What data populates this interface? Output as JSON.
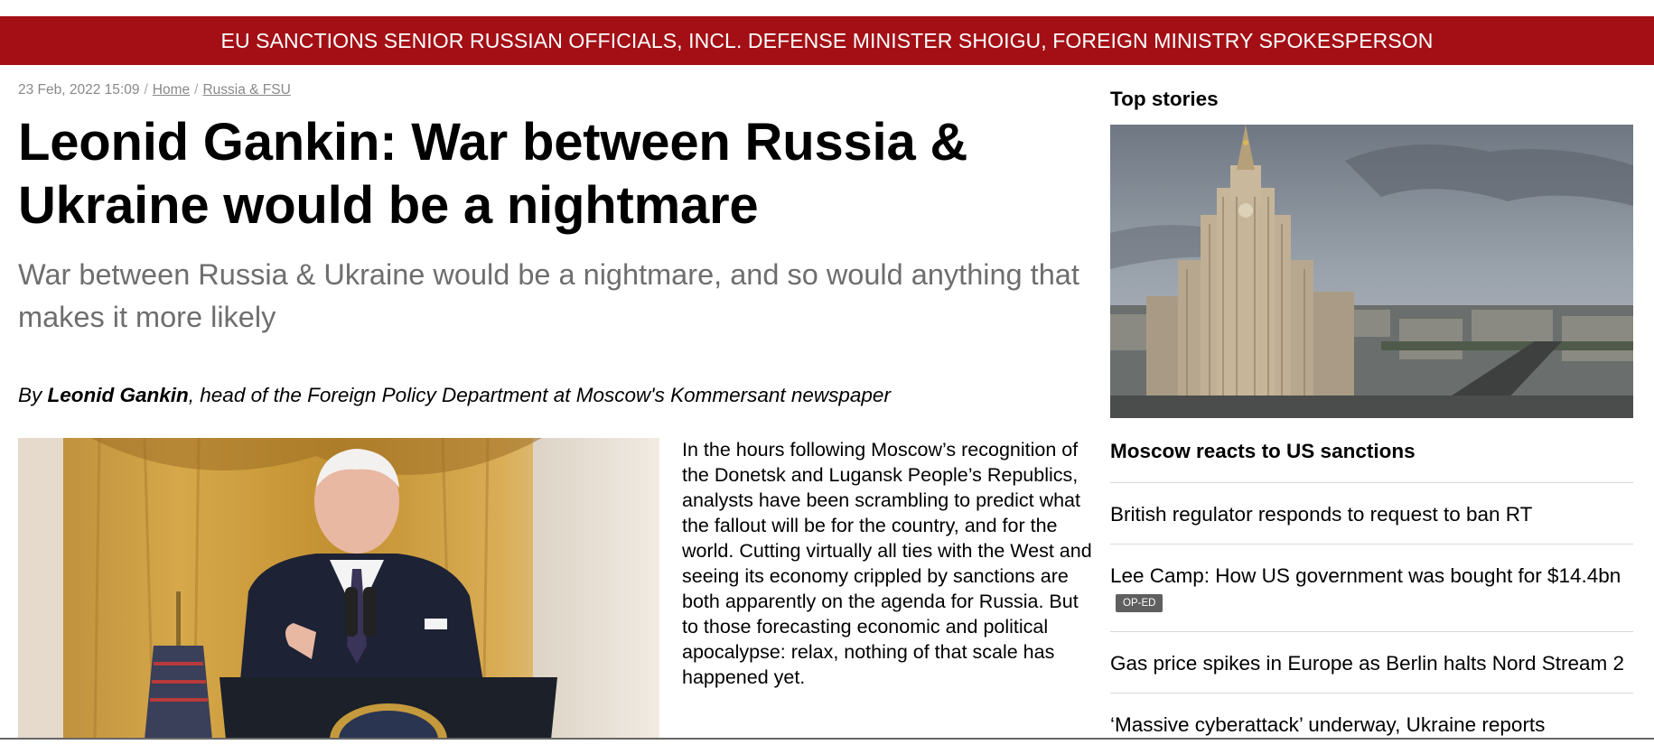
{
  "ticker": {
    "text": "EU SANCTIONS SENIOR RUSSIAN OFFICIALS, INCL. DEFENSE MINISTER SHOIGU, FOREIGN MINISTRY SPOKESPERSON"
  },
  "article": {
    "date": "23 Feb, 2022 15:09",
    "breadcrumbs": [
      "Home",
      "Russia & FSU"
    ],
    "headline": "Leonid Gankin: War between Russia & Ukraine would be a nightmare",
    "summary": "War between Russia & Ukraine would be a nightmare, and so would anything that makes it more likely",
    "byline": {
      "prefix": "By ",
      "author": "Leonid Gankin",
      "suffix": ", head of the Foreign Policy Department at Moscow's Kommersant newspaper"
    },
    "body": "In the hours following Moscow’s recognition of the Donetsk and Lugansk People’s Republics, analysts have been scrambling to predict what the fallout will be for the country, and for the world. Cutting virtually all ties with the West and seeing its economy crippled by sanctions are both apparently on the agenda for Russia. But to those forecasting economic and political apocalypse: relax, nothing of that scale has happened yet."
  },
  "sidebar": {
    "title": "Top stories",
    "lead_story": "Moscow reacts to US sanctions",
    "stories": [
      {
        "title": "British regulator responds to request to ban RT"
      },
      {
        "title": "Lee Camp: How US government was bought for $14.4bn",
        "badge": "OP-ED"
      },
      {
        "title": "Gas price spikes in Europe as Berlin halts Nord Stream 2"
      },
      {
        "title": "‘Massive cyberattack’ underway, Ukraine reports"
      }
    ]
  },
  "colors": {
    "ticker_bg": "#a30f15",
    "summary_text": "#6e6e6e",
    "badge_bg": "#5f5f5f"
  }
}
